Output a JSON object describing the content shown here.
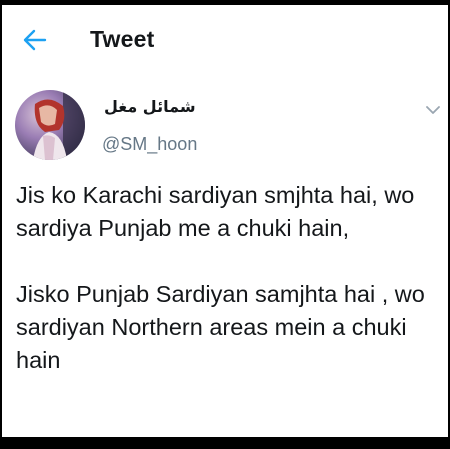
{
  "header": {
    "title": "Tweet",
    "back_icon": "arrow-left-icon"
  },
  "author": {
    "display_name": "شمائل مغل",
    "handle": "@SM_hoon"
  },
  "tweet": {
    "paragraph1": "Jis ko Karachi sardiyan smjhta hai, wo sardiya Punjab me a chuki hain,",
    "paragraph2": "Jisko Punjab Sardiyan samjhta hai , wo sardiyan Northern areas mein a chuki hain"
  },
  "colors": {
    "accent": "#1da1f2",
    "text": "#14171a",
    "secondary_text": "#657786",
    "background": "#ffffff",
    "frame": "#000000"
  }
}
